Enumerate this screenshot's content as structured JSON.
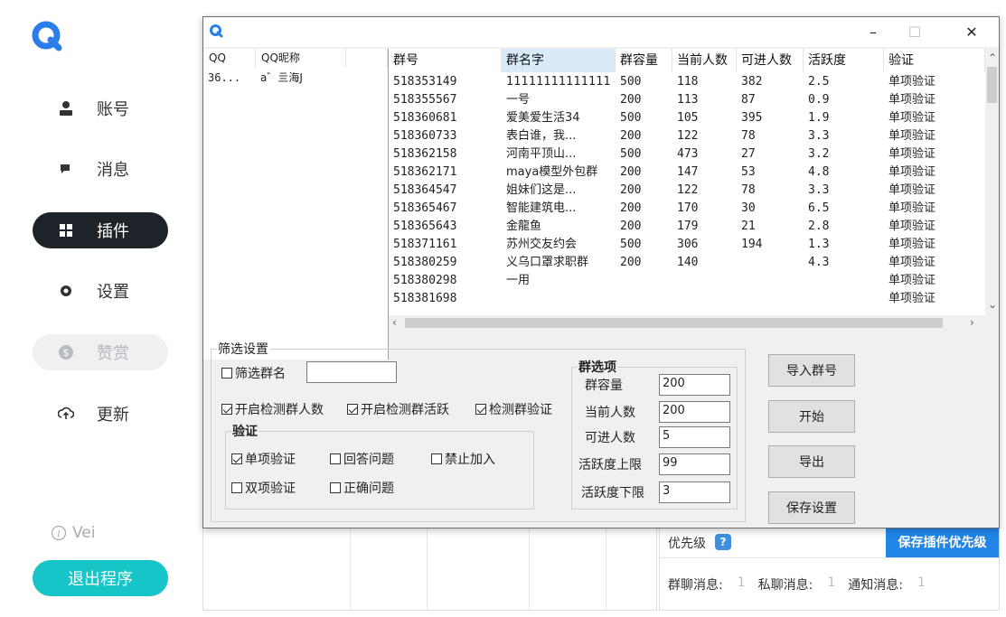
{
  "app": {
    "nav": [
      {
        "label": "账号",
        "icon": "user-icon"
      },
      {
        "label": "消息",
        "icon": "chat-icon"
      },
      {
        "label": "插件",
        "icon": "plugin-icon",
        "active": true
      },
      {
        "label": "设置",
        "icon": "gear-icon"
      },
      {
        "label": "赞赏",
        "icon": "dollar-icon",
        "disabled": true
      },
      {
        "label": "更新",
        "icon": "cloud-upload-icon"
      }
    ],
    "version_label": "Vei",
    "exit_label": "退出程序",
    "accent_color": "#17c5c8",
    "priority": {
      "title": "优先级",
      "help": "?",
      "save_label": "保存插件优先级",
      "group_msg_label": "群聊消息:",
      "group_msg_value": "1",
      "private_msg_label": "私聊消息:",
      "private_msg_value": "1",
      "notice_msg_label": "通知消息:",
      "notice_msg_value": "1"
    }
  },
  "window": {
    "minimize": "–",
    "maximize": "☐",
    "close": "✕",
    "qq_list": {
      "columns": [
        "QQ",
        "QQ昵称"
      ],
      "rows": [
        [
          "36...",
          "a゛亖海J"
        ]
      ]
    },
    "group_table": {
      "columns": [
        "群号",
        "群名字",
        "群容量",
        "当前人数",
        "可进人数",
        "活跃度",
        "验证"
      ],
      "rows": [
        [
          "518353149",
          "11111111111111",
          "500",
          "118",
          "382",
          "2.5",
          "单项验证"
        ],
        [
          "518355567",
          "一号",
          "200",
          "113",
          "87",
          "0.9",
          "单项验证"
        ],
        [
          "518360681",
          "爱美爱生活34",
          "500",
          "105",
          "395",
          "1.9",
          "单项验证"
        ],
        [
          "518360733",
          "表白谁，我...",
          "200",
          "122",
          "78",
          "3.3",
          "单项验证"
        ],
        [
          "518362158",
          "河南平顶山...",
          "500",
          "473",
          "27",
          "3.2",
          "单项验证"
        ],
        [
          "518362171",
          "maya模型外包群",
          "200",
          "147",
          "53",
          "4.8",
          "单项验证"
        ],
        [
          "518364547",
          "姐妹们这是...",
          "200",
          "122",
          "78",
          "3.3",
          "单项验证"
        ],
        [
          "518365467",
          "智能建筑电...",
          "200",
          "170",
          "30",
          "6.5",
          "单项验证"
        ],
        [
          "518365643",
          "金龍鱼",
          "200",
          "179",
          "21",
          "2.8",
          "单项验证"
        ],
        [
          "518371161",
          "苏州交友约会",
          "500",
          "306",
          "194",
          "1.3",
          "单项验证"
        ],
        [
          "518380259",
          "义乌口罩求职群",
          "200",
          "140",
          "",
          "4.3",
          "单项验证"
        ],
        [
          "518380298",
          "一用",
          "",
          "",
          "",
          "",
          "单项验证"
        ],
        [
          "518381698",
          "",
          "",
          "",
          "",
          "",
          "单项验证"
        ]
      ]
    },
    "filter": {
      "legend": "筛选设置",
      "filter_name_label": "筛选群名",
      "filter_name_value": "",
      "check_count_label": "开启检测群人数",
      "check_active_label": "开启检测群活跃",
      "check_verify_label": "检测群验证",
      "verify_legend": "验证",
      "single_label": "单项验证",
      "answer_label": "回答问题",
      "forbid_label": "禁止加入",
      "double_label": "双项验证",
      "correct_label": "正确问题",
      "group_options_legend": "群选项",
      "capacity_label": "群容量",
      "capacity_value": "200",
      "current_label": "当前人数",
      "current_value": "200",
      "joinable_label": "可进人数",
      "joinable_value": "5",
      "active_max_label": "活跃度上限",
      "active_max_value": "99",
      "active_min_label": "活跃度下限",
      "active_min_value": "3"
    },
    "buttons": {
      "import": "导入群号",
      "start": "开始",
      "export": "导出",
      "save": "保存设置"
    }
  }
}
